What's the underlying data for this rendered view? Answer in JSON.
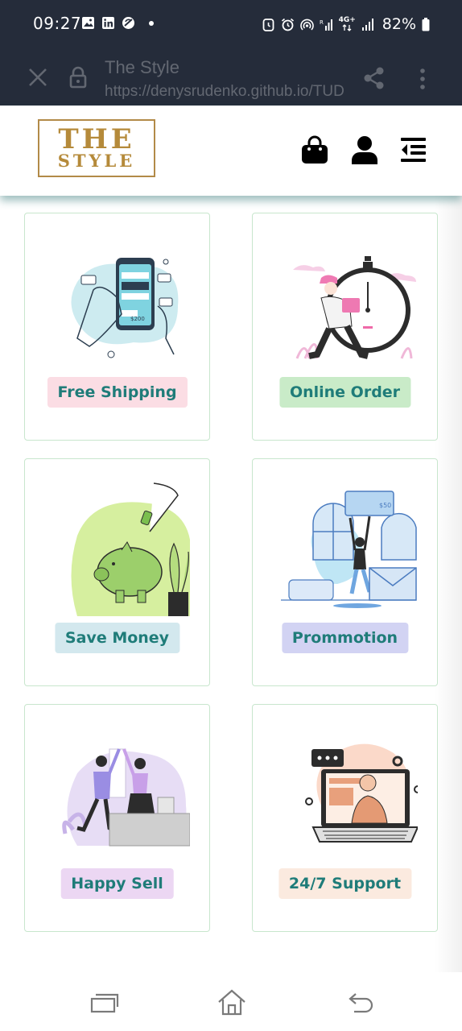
{
  "status_bar": {
    "time": "09:27",
    "network_label": "4G+",
    "battery": "82%"
  },
  "browser": {
    "page_title": "The Style",
    "url": "https://denysrudenko.github.io/TUD",
    "icons": [
      "close-icon",
      "lock-icon",
      "share-icon",
      "more-vert-icon"
    ]
  },
  "header": {
    "logo_line1": "THE",
    "logo_line2": "STYLE",
    "icons": [
      "shopping-bag-icon",
      "user-icon",
      "menu-icon"
    ],
    "colors": {
      "logo_gold": "#b58a3a",
      "shadow_teal": "#2a7a7a"
    }
  },
  "features": [
    {
      "label": "Free Shipping",
      "badge_color": "#fbdde4",
      "illustration": "payment-phone-illustration"
    },
    {
      "label": "Online Order",
      "badge_color": "#c9ebc8",
      "illustration": "courier-stopwatch-illustration"
    },
    {
      "label": "Save Money",
      "badge_color": "#d3e8ee",
      "illustration": "piggy-bank-illustration"
    },
    {
      "label": "Prommotion",
      "badge_color": "#d2d3f3",
      "illustration": "gift-celebration-illustration"
    },
    {
      "label": "Happy Sell",
      "badge_color": "#ecd7f3",
      "illustration": "high-five-illustration"
    },
    {
      "label": "24/7 Support",
      "badge_color": "#fbeadf",
      "illustration": "laptop-support-illustration"
    }
  ],
  "colors": {
    "badge_text": "#1f7c79",
    "card_border": "#c8e6cd",
    "status_bg": "#252c3a"
  },
  "nav_bar": {
    "icons": [
      "recent-apps-icon",
      "home-icon",
      "back-icon"
    ]
  }
}
